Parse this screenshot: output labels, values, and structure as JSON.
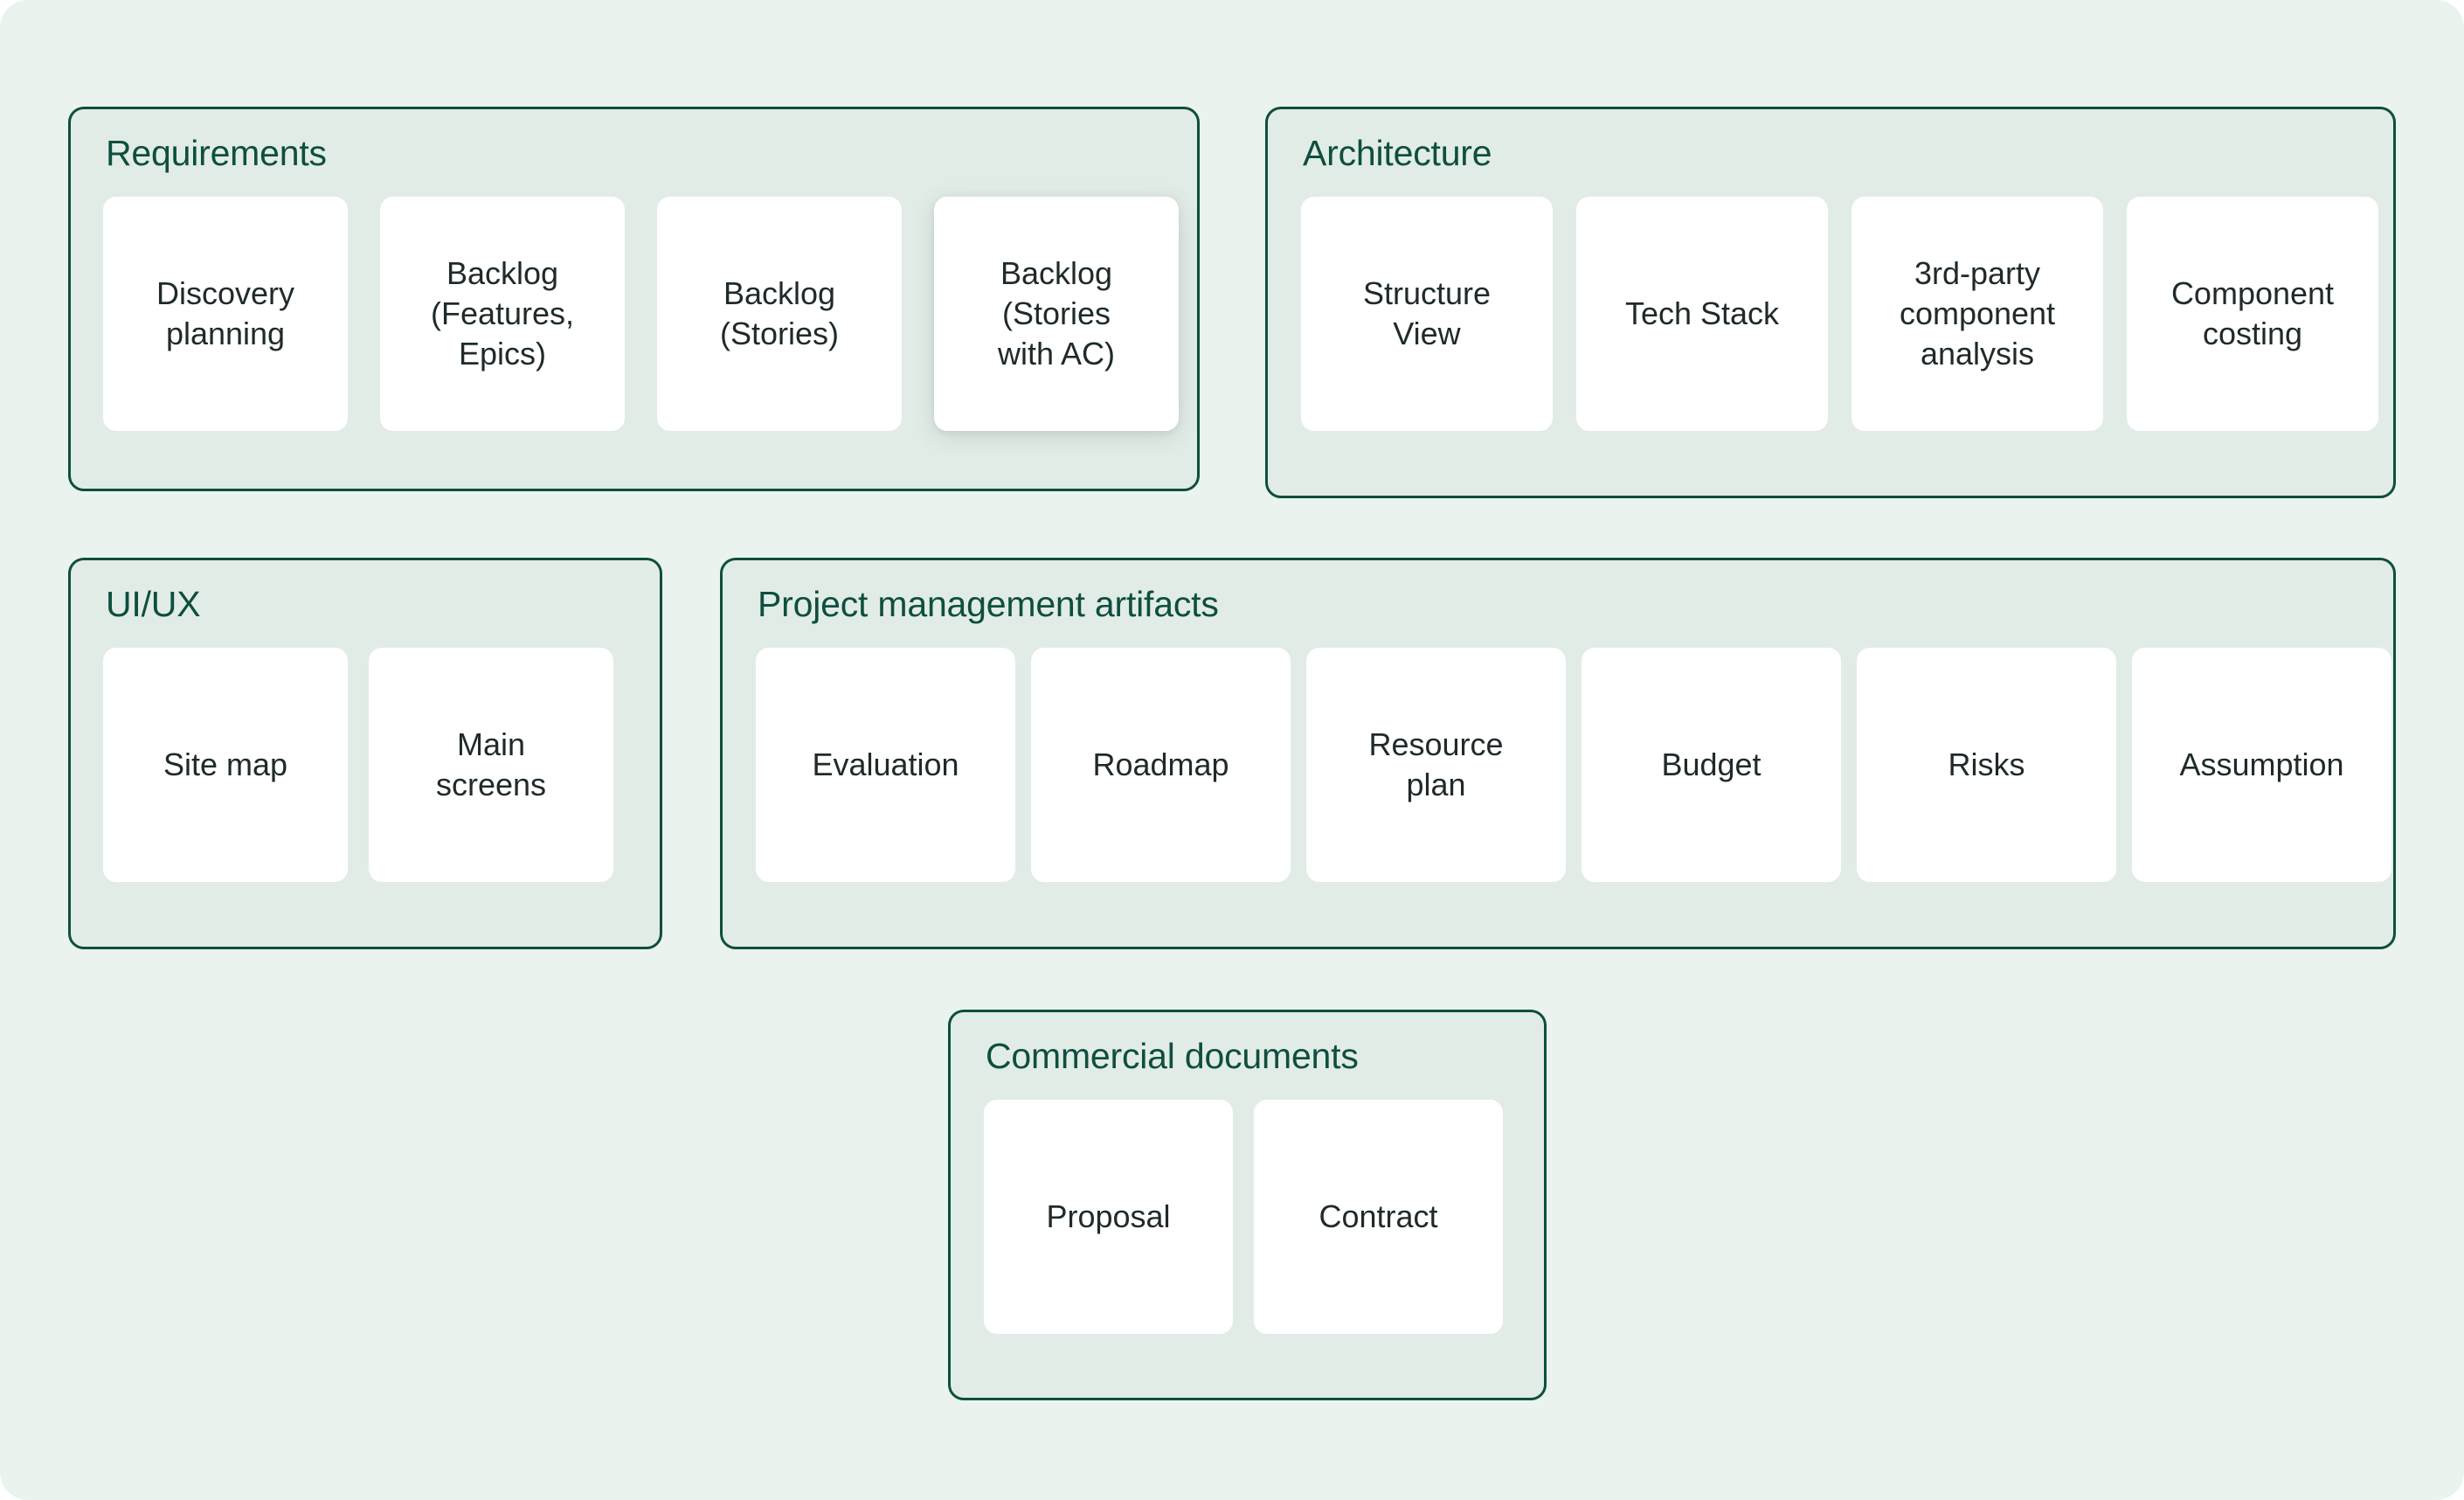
{
  "canvas": {
    "background_color": "#eaf3ee",
    "panel_fill_color": "#e2ece6",
    "panel_border_color": "#0d4f3c",
    "card_fill_color": "#ffffff",
    "title_color": "#0e4f3f",
    "card_label_color": "#1f2a2a"
  },
  "groups": [
    {
      "id": "requirements",
      "title": "Requirements",
      "cards": [
        {
          "label": "Discovery\nplanning",
          "highlighted": false
        },
        {
          "label": "Backlog\n(Features,\nEpics)",
          "highlighted": false
        },
        {
          "label": "Backlog\n(Stories)",
          "highlighted": false
        },
        {
          "label": "Backlog\n(Stories\nwith AC)",
          "highlighted": true
        }
      ]
    },
    {
      "id": "architecture",
      "title": "Architecture",
      "cards": [
        {
          "label": "Structure\nView",
          "highlighted": false
        },
        {
          "label": "Tech Stack",
          "highlighted": false
        },
        {
          "label": "3rd-party\ncomponent\nanalysis",
          "highlighted": false
        },
        {
          "label": "Component\ncosting",
          "highlighted": false
        }
      ]
    },
    {
      "id": "uiux",
      "title": "UI/UX",
      "cards": [
        {
          "label": "Site map",
          "highlighted": false
        },
        {
          "label": "Main\nscreens",
          "highlighted": false
        }
      ]
    },
    {
      "id": "pm",
      "title": "Project management artifacts",
      "cards": [
        {
          "label": "Evaluation",
          "highlighted": false
        },
        {
          "label": "Roadmap",
          "highlighted": false
        },
        {
          "label": "Resource\nplan",
          "highlighted": false
        },
        {
          "label": "Budget",
          "highlighted": false
        },
        {
          "label": "Risks",
          "highlighted": false
        },
        {
          "label": "Assumption",
          "highlighted": false
        }
      ]
    },
    {
      "id": "commercial",
      "title": "Commercial documents",
      "cards": [
        {
          "label": "Proposal",
          "highlighted": false
        },
        {
          "label": "Contract",
          "highlighted": false
        }
      ]
    }
  ]
}
